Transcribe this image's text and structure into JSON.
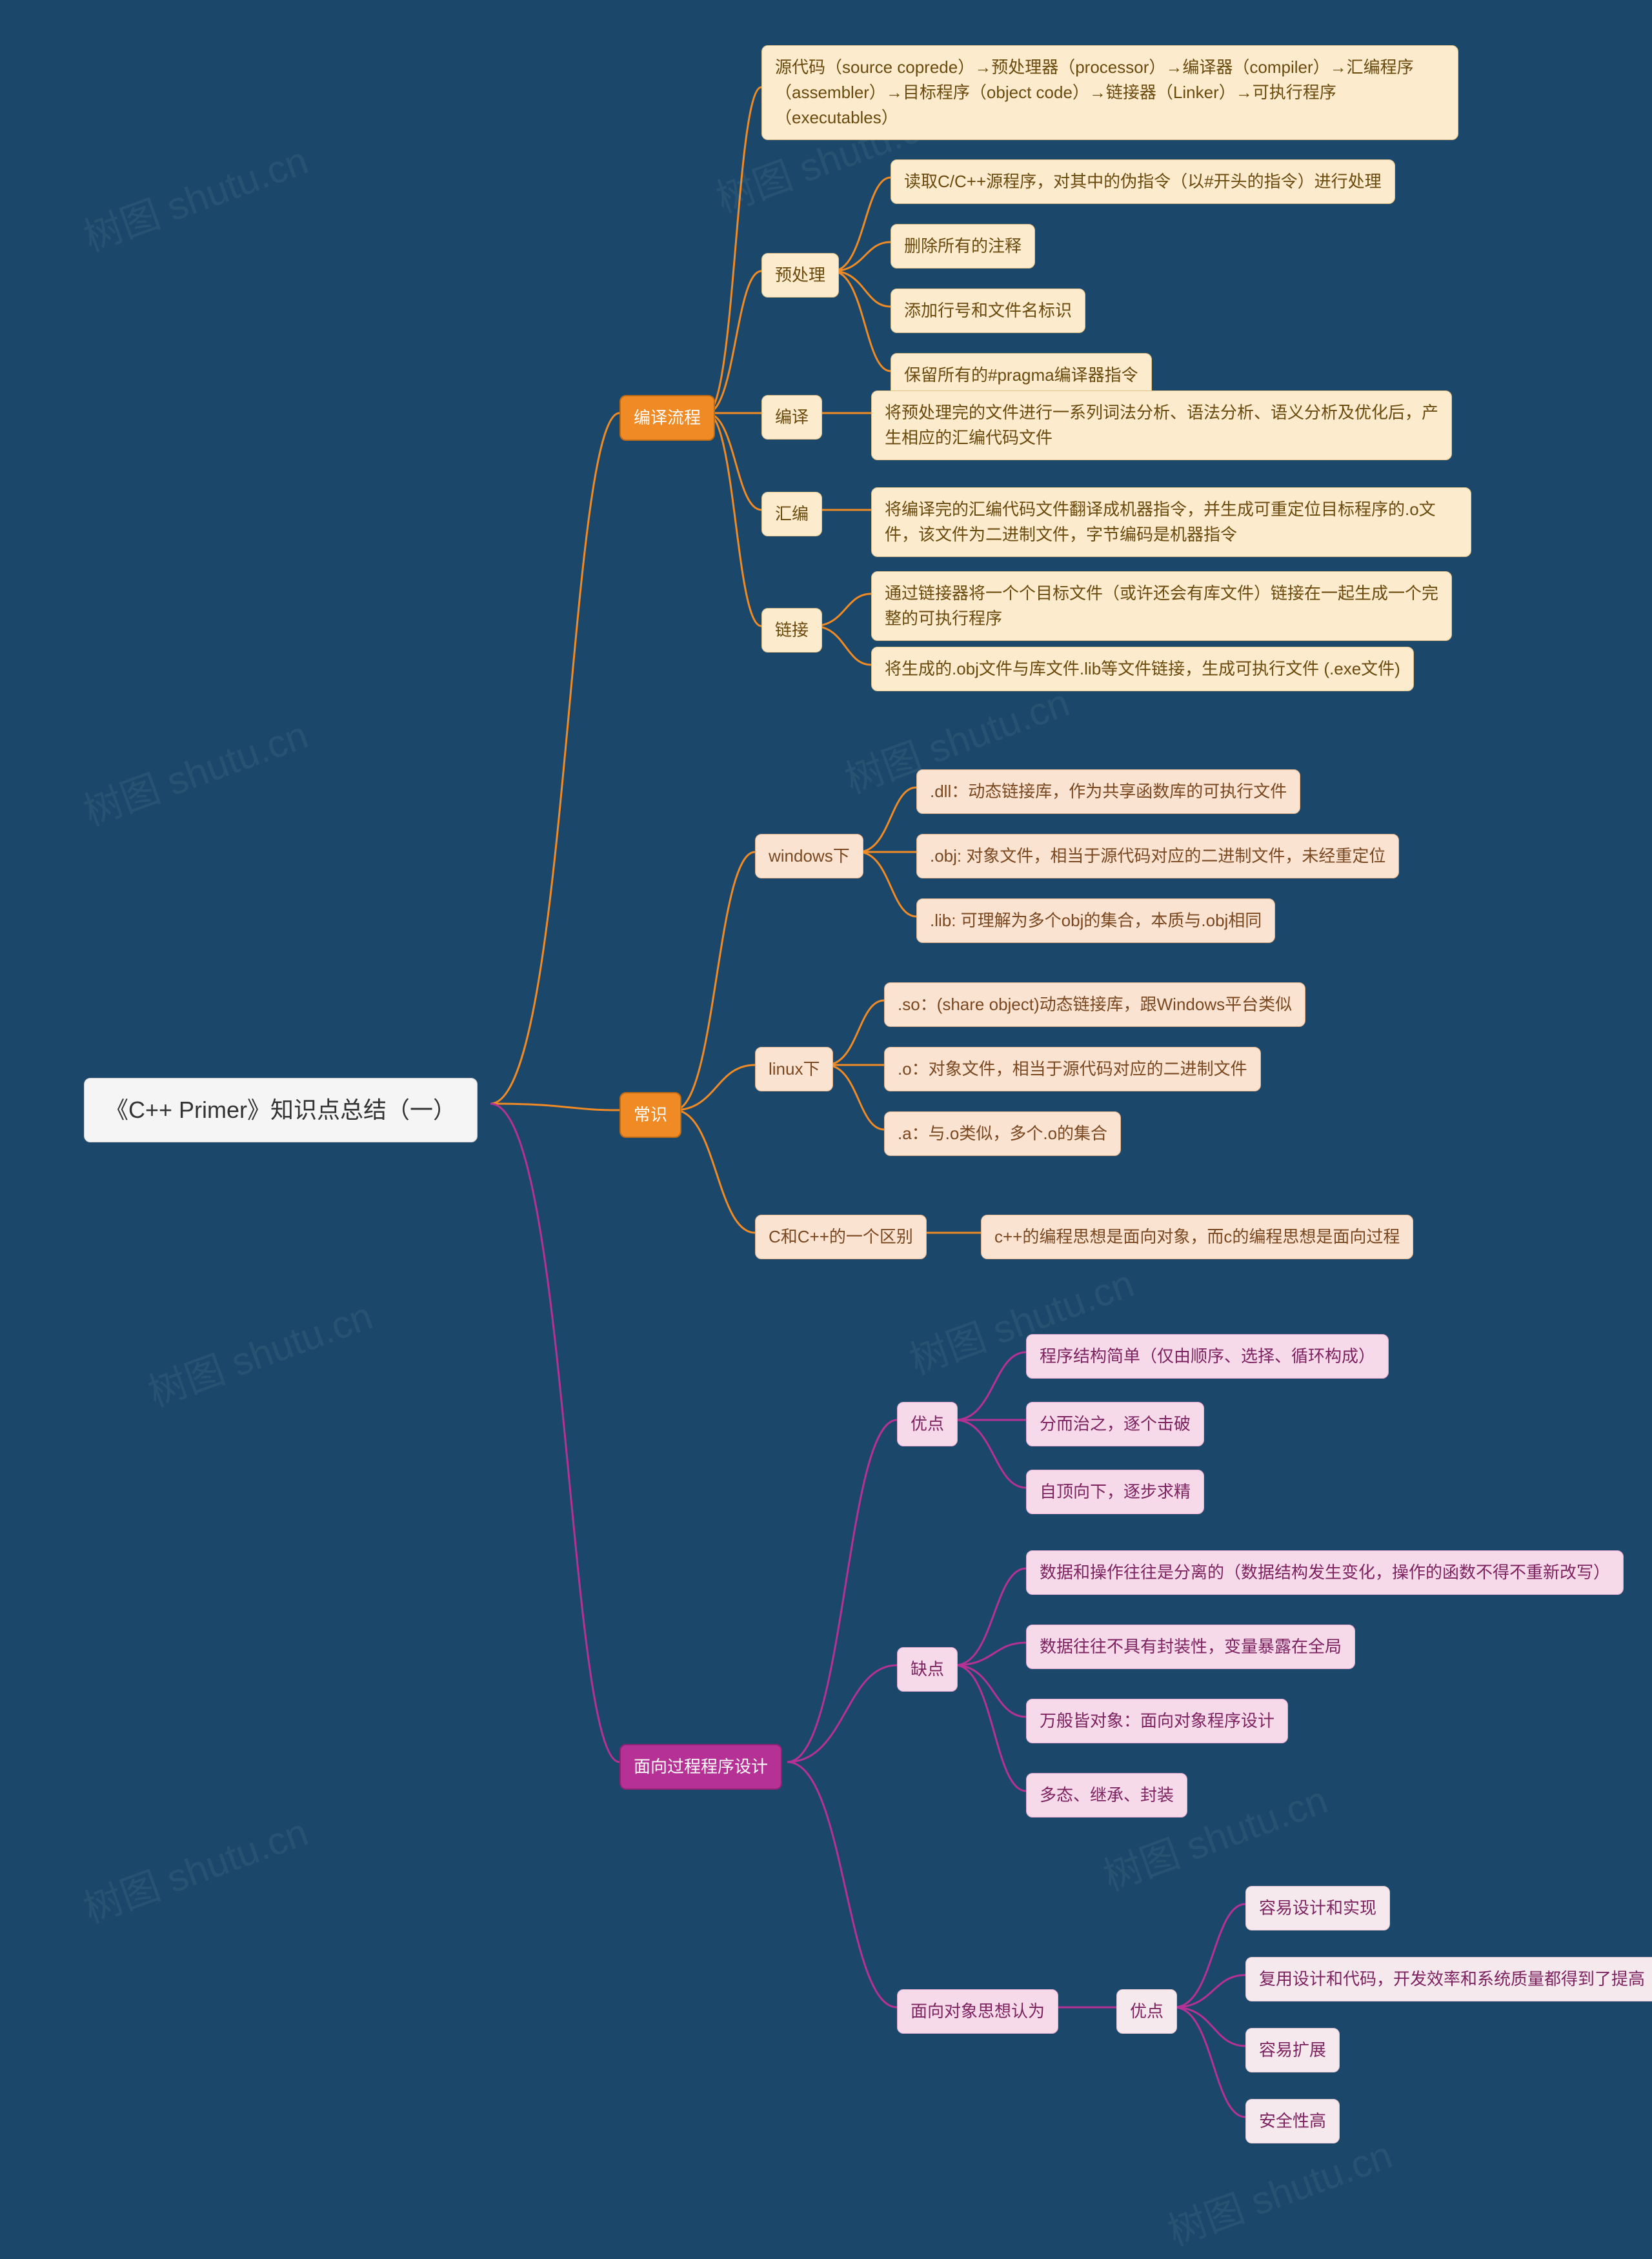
{
  "watermark": "树图 shutu.cn",
  "root": "《C++ Primer》知识点总结（一）",
  "branch1": {
    "title": "编译流程",
    "overview": "源代码（source coprede）→预处理器（processor）→编译器（compiler）→汇编程序（assembler）→目标程序（object code）→链接器（Linker）→可执行程序（executables）",
    "preprocess": {
      "title": "预处理",
      "items": [
        "读取C/C++源程序，对其中的伪指令（以#开头的指令）进行处理",
        "删除所有的注释",
        "添加行号和文件名标识",
        "保留所有的#pragma编译器指令"
      ]
    },
    "compile": {
      "title": "编译",
      "desc": "将预处理完的文件进行一系列词法分析、语法分析、语义分析及优化后，产生相应的汇编代码文件"
    },
    "assemble": {
      "title": "汇编",
      "desc": "将编译完的汇编代码文件翻译成机器指令，并生成可重定位目标程序的.o文件，该文件为二进制文件，字节编码是机器指令"
    },
    "link": {
      "title": "链接",
      "items": [
        "通过链接器将一个个目标文件（或许还会有库文件）链接在一起生成一个完整的可执行程序",
        "将生成的.obj文件与库文件.lib等文件链接，生成可执行文件 (.exe文件)"
      ]
    }
  },
  "branch2": {
    "title": "常识",
    "windows": {
      "title": "windows下",
      "items": [
        ".dll：动态链接库，作为共享函数库的可执行文件",
        ".obj: 对象文件，相当于源代码对应的二进制文件，未经重定位",
        ".lib: 可理解为多个obj的集合，本质与.obj相同"
      ]
    },
    "linux": {
      "title": "linux下",
      "items": [
        ".so：(share object)动态链接库，跟Windows平台类似",
        ".o：对象文件，相当于源代码对应的二进制文件",
        ".a：与.o类似，多个.o的集合"
      ]
    },
    "diff": {
      "title": "C和C++的一个区别",
      "desc": "c++的编程思想是面向对象，而c的编程思想是面向过程"
    }
  },
  "branch3": {
    "title": "面向过程程序设计",
    "pros": {
      "title": "优点",
      "items": [
        "程序结构简单（仅由顺序、选择、循环构成）",
        "分而治之，逐个击破",
        "自顶向下，逐步求精"
      ]
    },
    "cons": {
      "title": "缺点",
      "items": [
        "数据和操作往往是分离的（数据结构发生变化，操作的函数不得不重新改写）",
        "数据往往不具有封装性，变量暴露在全局",
        "万般皆对象：面向对象程序设计",
        "多态、继承、封装"
      ]
    },
    "oo": {
      "title": "面向对象思想认为",
      "pros_label": "优点",
      "items": [
        "容易设计和实现",
        "复用设计和代码，开发效率和系统质量都得到了提高",
        "容易扩展",
        "安全性高"
      ]
    }
  }
}
